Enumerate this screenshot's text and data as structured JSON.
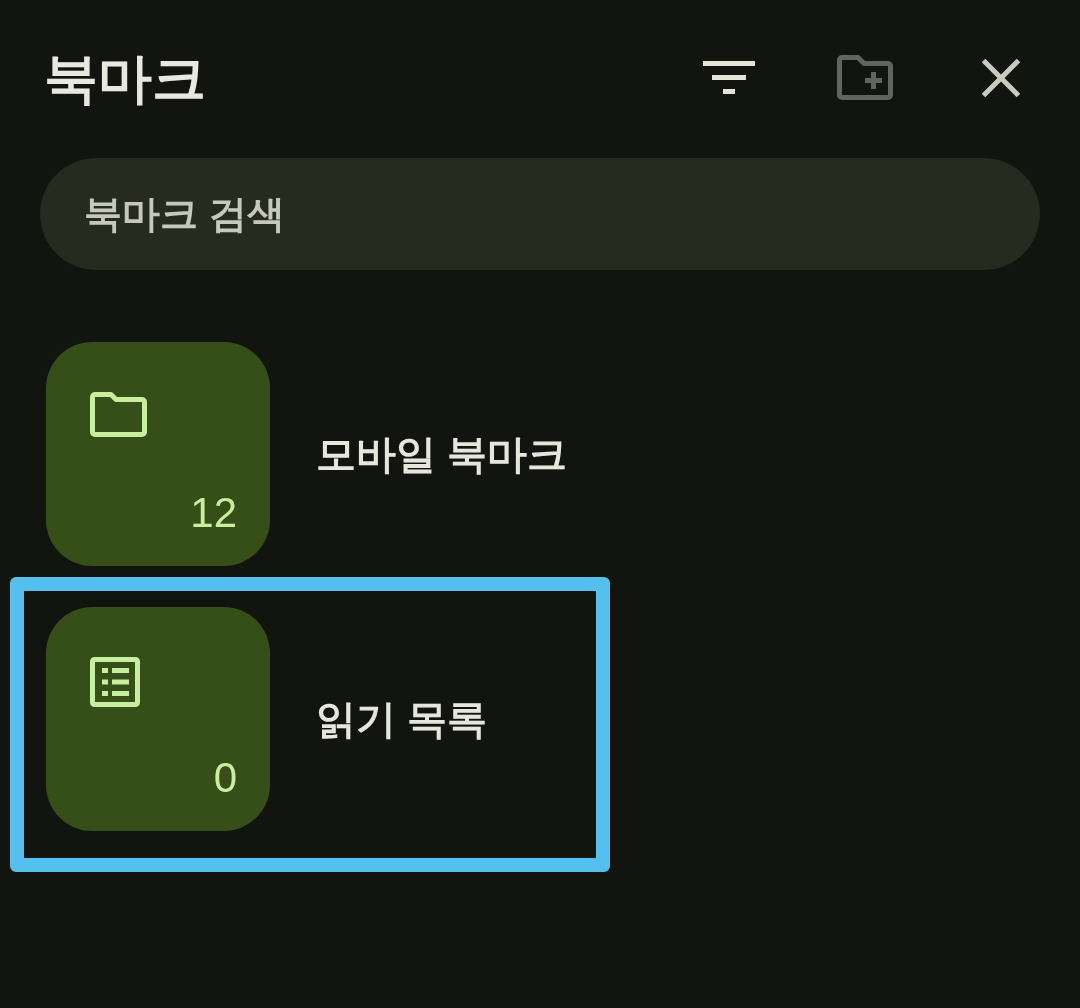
{
  "header": {
    "title": "북마크",
    "actions": [
      {
        "kind": "filter",
        "disabled": false
      },
      {
        "kind": "new_folder",
        "disabled": true
      },
      {
        "kind": "close",
        "disabled": false
      }
    ]
  },
  "search": {
    "placeholder": "북마크 검색"
  },
  "items": [
    {
      "kind": "folder",
      "title": "모바일 북마크",
      "count": "12",
      "selected": false
    },
    {
      "kind": "reading_list",
      "title": "읽기 목록",
      "count": "0",
      "selected": true
    }
  ]
}
